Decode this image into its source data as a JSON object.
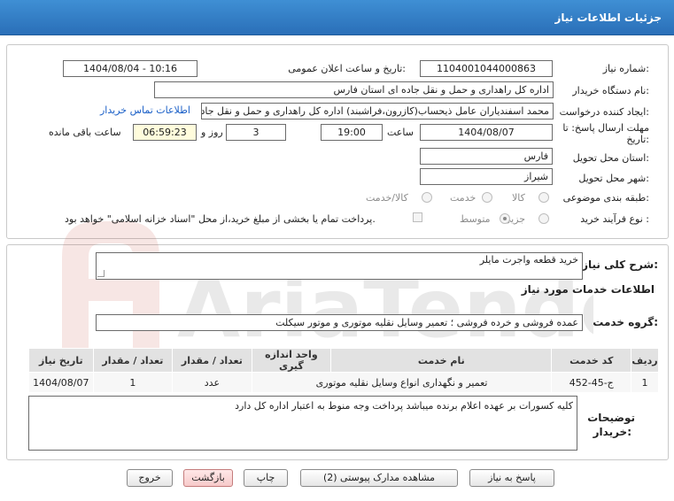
{
  "header": {
    "title": "جزئیات اطلاعات نیاز"
  },
  "form": {
    "need_number_label": "شماره نیاز:",
    "need_number": "1104001044000863",
    "announce_label": "تاریخ و ساعت اعلان عمومی:",
    "announce_value": "1404/08/04 - 10:16",
    "buyer_org_label": "نام دستگاه خریدار:",
    "buyer_org": "اداره کل راهداری و حمل و نقل جاده ای استان فارس",
    "requester_label": "ایجاد کننده درخواست:",
    "requester": "محمد اسفندیاران عامل ذیحساب(کازرون،فراشبند) اداره کل راهداری و حمل و نقل جاده ای",
    "contact_link": "اطلاعات تماس خریدار",
    "deadline_label_1": "مهلت ارسال پاسخ: تا",
    "deadline_label_2": "تاریخ:",
    "deadline_date": "1404/08/07",
    "time_label": "ساعت",
    "deadline_time": "19:00",
    "days_value": "3",
    "days_label": "روز و",
    "remaining_time": "06:59:23",
    "remaining_label": "ساعت باقی مانده",
    "province_label": "استان محل تحویل:",
    "province": "فارس",
    "city_label": "شهر محل تحویل:",
    "city": "شیراز",
    "category_label": "طبقه بندی موضوعی:",
    "category_options": [
      "کالا",
      "خدمت",
      "کالا/خدمت"
    ],
    "process_label": "نوع فرآیند خرید :",
    "process_options": [
      "جزیی",
      "متوسط"
    ],
    "payment_note": "پرداخت تمام یا بخشی از مبلغ خرید،از محل \"اسناد خزانه اسلامی\" خواهد بود."
  },
  "summary": {
    "label": "شرح کلی نیاز:",
    "value": "خرید قطعه واجرت مایلر"
  },
  "services": {
    "section_title": "اطلاعات خدمات مورد نیاز",
    "group_label": "گروه خدمت:",
    "group_value": "عمده فروشی و خرده فروشی ؛ تعمیر وسایل نقلیه موتوری و موتور سیکلت",
    "columns": [
      "ردیف",
      "کد خدمت",
      "نام خدمت",
      "واحد اندازه گیری",
      "تعداد / مقدار",
      "تاریخ نیاز"
    ],
    "rows": [
      [
        "1",
        "ج-45-452",
        "تعمیر و نگهداری انواع وسایل نقلیه موتوری",
        "عدد",
        "1",
        "1404/08/07"
      ]
    ]
  },
  "notes": {
    "label_1": "توضیحات",
    "label_2": "خریدار:",
    "value": "کلیه کسورات بر عهده اعلام برنده میباشد پرداخت وجه منوط به اعتبار اداره کل دارد"
  },
  "buttons": {
    "reply": "پاسخ به نیاز",
    "docs": "مشاهده مدارک پیوستی (2)",
    "print": "چاپ",
    "back": "بازگشت",
    "exit": "خروج"
  },
  "watermark": {
    "text": "AriaTender.net"
  },
  "colors": {
    "header": "#2a6fb8",
    "link": "#1a5fc7",
    "highlight": "#fffcdc"
  }
}
